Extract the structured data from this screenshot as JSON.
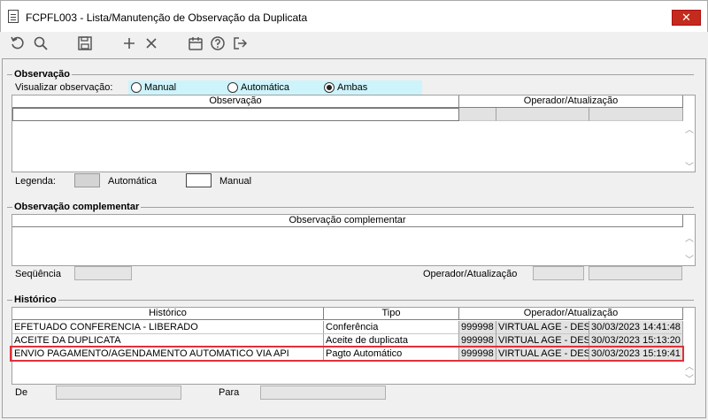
{
  "window": {
    "title": "FCPFL003 - Lista/Manutenção de Observação da Duplicata",
    "close_glyph": "✕"
  },
  "toolbar": {
    "icons": [
      "refresh-icon",
      "search-icon",
      "save-icon",
      "add-icon",
      "delete-icon",
      "calendar-icon",
      "help-icon",
      "exit-icon"
    ]
  },
  "observacao": {
    "group_title": "Observação",
    "view_label": "Visualizar observação:",
    "radio_options": [
      {
        "label": "Manual",
        "selected": false
      },
      {
        "label": "Automática",
        "selected": false
      },
      {
        "label": "Ambas",
        "selected": true
      }
    ],
    "col_observacao": "Observação",
    "col_operador": "Operador/Atualização",
    "legend_label": "Legenda:",
    "legend_auto": "Automática",
    "legend_manual": "Manual",
    "legend_auto_color": "#d4d4d4",
    "legend_manual_color": "#ffffff"
  },
  "complementar": {
    "group_title": "Observação complementar",
    "col_header": "Observação complementar",
    "sequencia_label": "Seqüência",
    "operador_label": "Operador/Atualização"
  },
  "historico": {
    "group_title": "Histórico",
    "columns": [
      "Histórico",
      "Tipo",
      "Operador/Atualização"
    ],
    "rows": [
      {
        "historico": "EFETUADO CONFERENCIA - LIBERADO",
        "tipo": "Conferência",
        "cod": "999998",
        "operador": "VIRTUAL AGE - DESEN",
        "data": "30/03/2023 14:41:48"
      },
      {
        "historico": "ACEITE DA DUPLICATA",
        "tipo": "Aceite de duplicata",
        "cod": "999998",
        "operador": "VIRTUAL AGE - DESEN",
        "data": "30/03/2023 15:13:20"
      },
      {
        "historico": "ENVIO PAGAMENTO/AGENDAMENTO AUTOMATICO VIA API",
        "tipo": "Pagto Automático",
        "cod": "999998",
        "operador": "VIRTUAL AGE - DESEN",
        "data": "30/03/2023 15:19:41"
      }
    ],
    "highlighted_row_index": 2,
    "highlight_color": "#e0303a",
    "de_label": "De",
    "para_label": "Para"
  }
}
